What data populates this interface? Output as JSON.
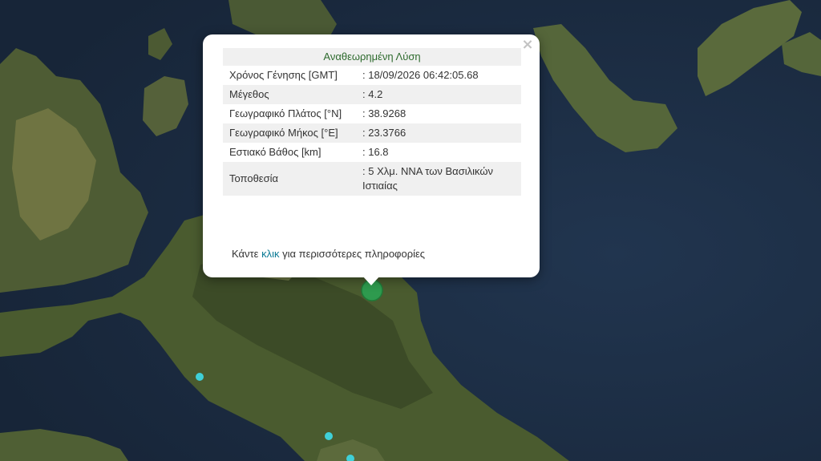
{
  "map": {
    "colors": {
      "sea": "#1e3048",
      "land_dark": "#3a4a2a",
      "land_mid": "#58683a",
      "land_light": "#8a8a5a",
      "epicenter": "#2e9a4e",
      "minor_quake": "#3fd0d8"
    },
    "epicenter_icon": "main-earthquake-marker-icon",
    "minor_icon": "minor-earthquake-marker-icon"
  },
  "popup": {
    "close": "×",
    "title": "Αναθεωρημένη Λύση",
    "rows": [
      {
        "label": "Χρόνος Γένησης [GMT]",
        "value": ": 18/09/2026 06:42:05.68"
      },
      {
        "label": "Μέγεθος",
        "value": ": 4.2"
      },
      {
        "label": "Γεωγραφικό Πλάτος [°N]",
        "value": ": 38.9268"
      },
      {
        "label": "Γεωγραφικό Μήκος [°E]",
        "value": ": 23.3766"
      },
      {
        "label": "Εστιακό Βάθος [km]",
        "value": ": 16.8"
      },
      {
        "label": "Τοποθεσία",
        "value": ": 5 Χλμ. ΝΝΑ των Βασιλικών Ιστιαίας"
      }
    ],
    "more_prefix": "Κάντε ",
    "more_link": "κλικ",
    "more_suffix": " για περισσότερες πληροφορίες"
  }
}
